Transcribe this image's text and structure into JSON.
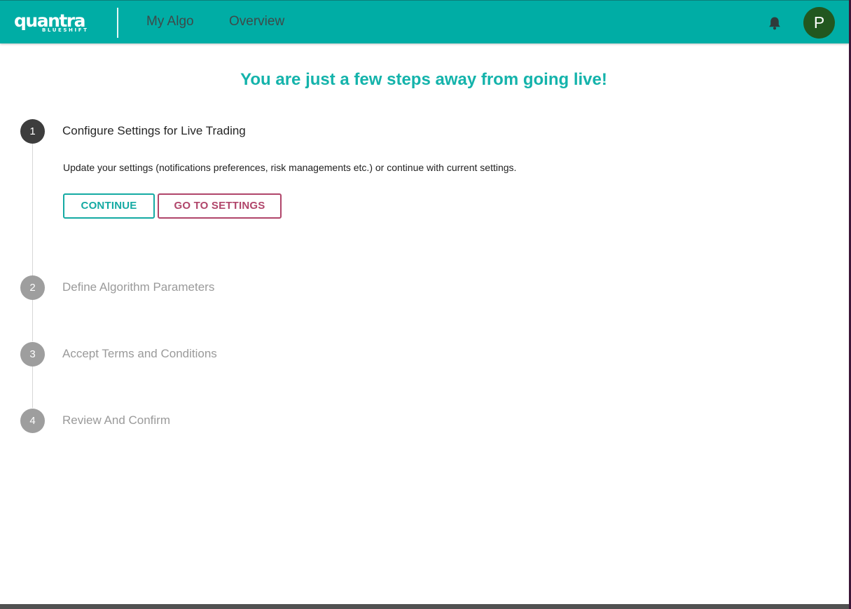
{
  "header": {
    "logo_text": "quantra",
    "logo_subtext": "BLUESHIFT",
    "nav": [
      "My Algo",
      "Overview"
    ],
    "notification_icon": "bell-icon",
    "avatar_initial": "P",
    "colors": {
      "topbar": "#00ada5",
      "avatar": "#22571f"
    }
  },
  "main": {
    "headline": "You are just a few steps away from going live!",
    "steps": [
      {
        "number": "1",
        "title": "Configure Settings for Live Trading",
        "active": true,
        "description": "Update your settings (notifications preferences, risk managements etc.) or continue with current settings.",
        "buttons": {
          "continue": "CONTINUE",
          "settings": "GO TO SETTINGS"
        }
      },
      {
        "number": "2",
        "title": "Define Algorithm Parameters",
        "active": false
      },
      {
        "number": "3",
        "title": "Accept Terms and Conditions",
        "active": false
      },
      {
        "number": "4",
        "title": "Review And Confirm",
        "active": false
      }
    ],
    "colors": {
      "accent": "#14b3ab",
      "secondary": "#b0456a",
      "active_step": "#3d3d3d",
      "inactive_step": "#9e9e9e"
    }
  }
}
